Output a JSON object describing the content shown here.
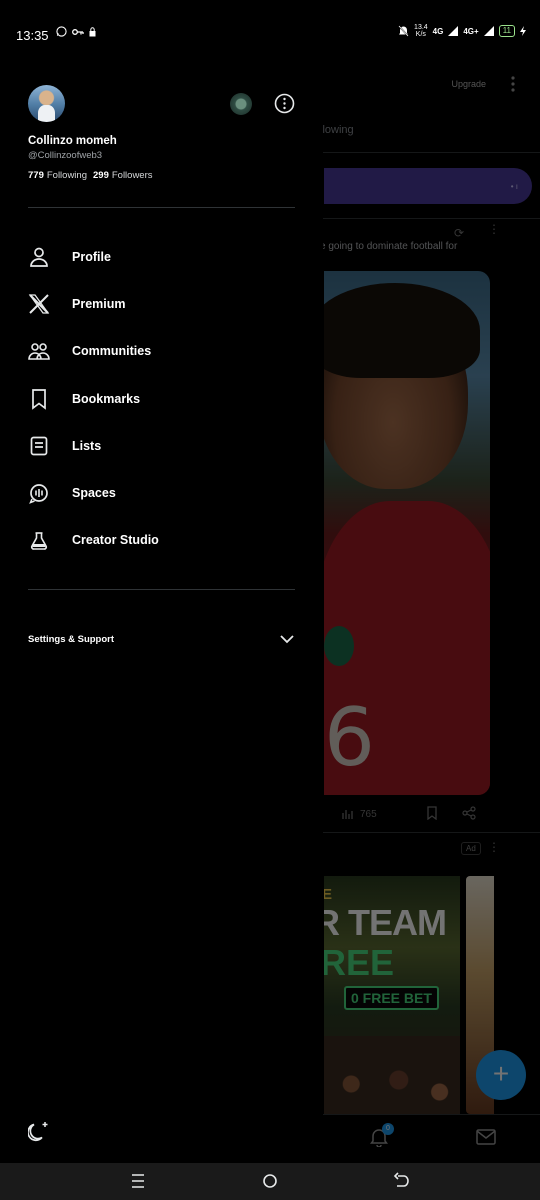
{
  "status_bar": {
    "time": "13:35",
    "net_speed_top": "13.4",
    "net_speed_bottom": "K/s",
    "net1": "4G",
    "net2": "4G+",
    "battery": "11"
  },
  "drawer": {
    "profile": {
      "name": "Collinzo momeh",
      "handle": "@Collinzoofweb3",
      "following_count": "779",
      "following_label": "Following",
      "followers_count": "299",
      "followers_label": "Followers"
    },
    "menu": [
      {
        "label": "Profile",
        "icon": "person-icon"
      },
      {
        "label": "Premium",
        "icon": "x-logo-icon"
      },
      {
        "label": "Communities",
        "icon": "communities-icon"
      },
      {
        "label": "Bookmarks",
        "icon": "bookmark-icon"
      },
      {
        "label": "Lists",
        "icon": "lists-icon"
      },
      {
        "label": "Spaces",
        "icon": "spaces-icon"
      },
      {
        "label": "Creator Studio",
        "icon": "creator-studio-icon"
      }
    ],
    "settings_label": "Settings & Support"
  },
  "timeline": {
    "upgrade_label": "Upgrade",
    "tab_label": "llowing",
    "post_text": "e going to dominate football for",
    "views": "765",
    "ad_label": "Ad",
    "ad_line1": "E",
    "ad_line2": "R TEAM",
    "ad_line3": "REE",
    "ad_freebet": "0 FREE BET",
    "jersey_number": "6",
    "notification_count": "0"
  },
  "colors": {
    "background": "#000000",
    "accent": "#1d9bf0",
    "banner": "#4b3a9c",
    "divider": "#2f3336"
  }
}
